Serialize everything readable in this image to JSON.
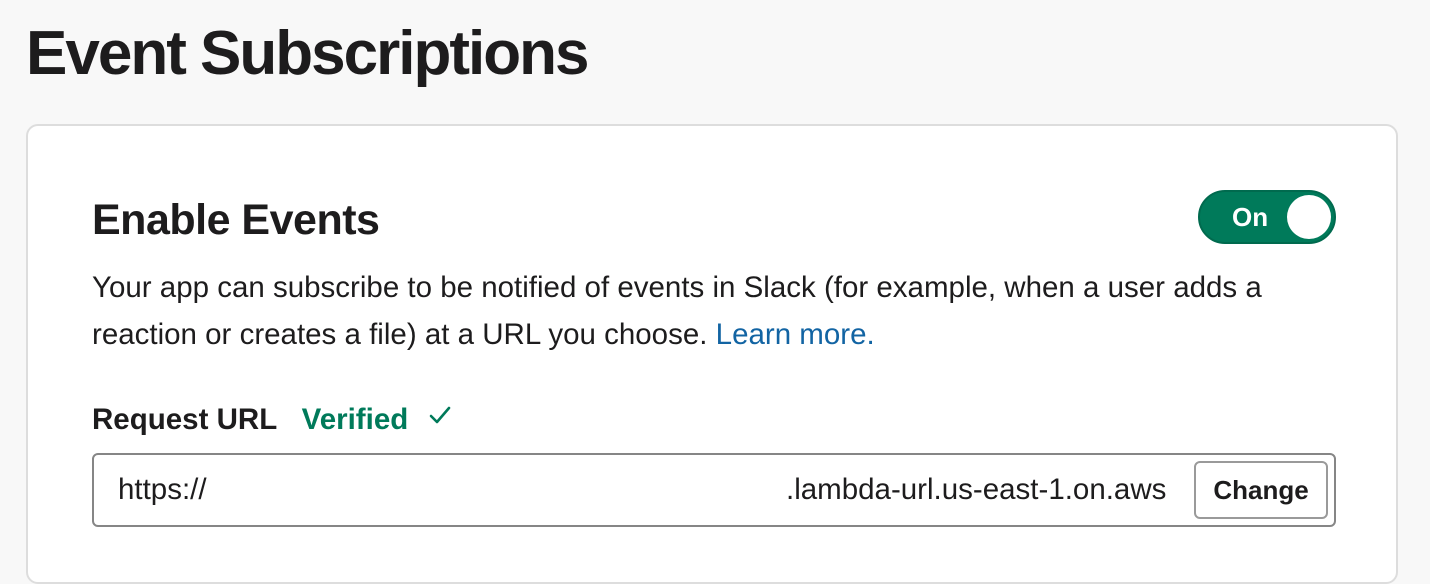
{
  "page": {
    "title": "Event Subscriptions"
  },
  "enable_events": {
    "title": "Enable Events",
    "toggle_label": "On",
    "toggle_state": "on",
    "description": "Your app can subscribe to be notified of events in Slack (for example, when a user adds a reaction or creates a file) at a URL you choose.",
    "learn_more_label": "Learn more."
  },
  "request_url": {
    "label": "Request URL",
    "status": "Verified",
    "status_icon": "check-icon",
    "value_prefix": "https://",
    "value_suffix": ".lambda-url.us-east-1.on.aws",
    "change_label": "Change"
  },
  "colors": {
    "toggle_on": "#007a5a",
    "verified": "#007a5a",
    "link": "#1264a3",
    "text": "#1d1c1d",
    "page_background": "#f8f8f8"
  }
}
